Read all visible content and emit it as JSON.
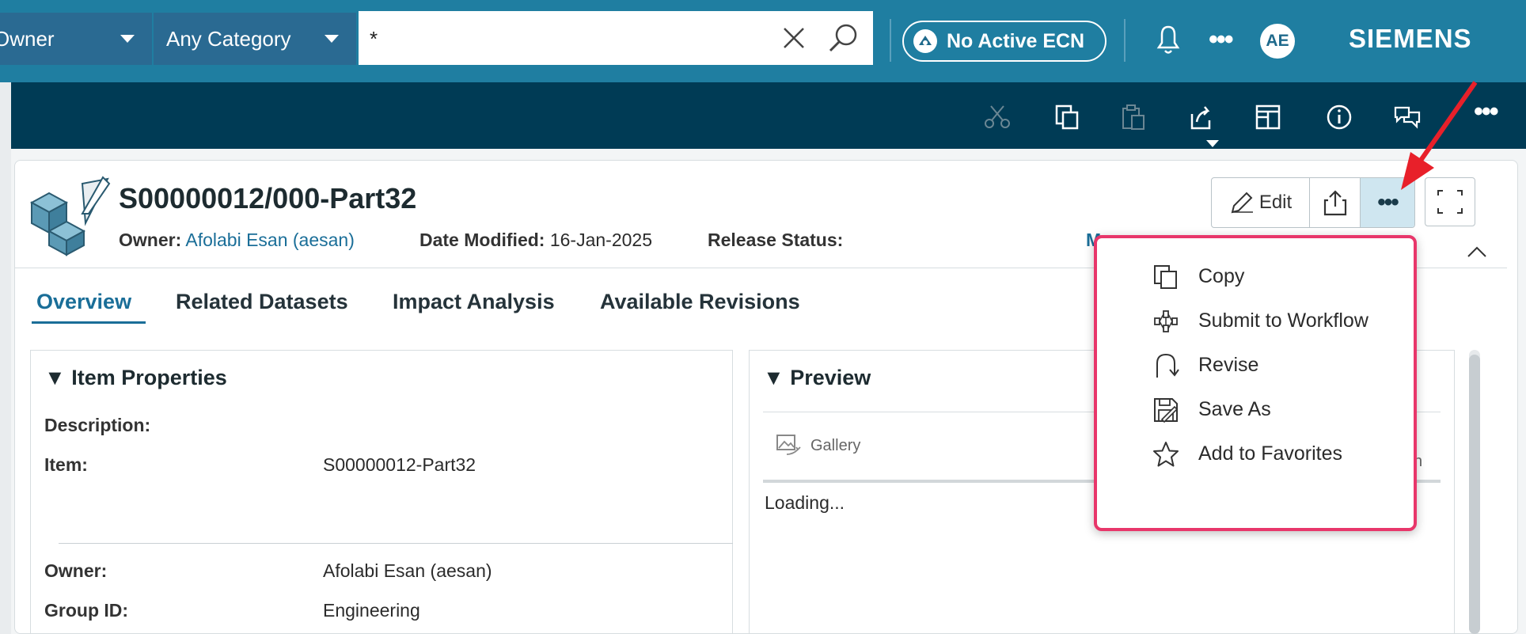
{
  "colors": {
    "header_bg": "#1f7ea1",
    "toolbar_bg": "#003b55",
    "accent": "#1a6e98",
    "highlight_border": "#e8366a",
    "annotation_arrow": "#e8202a"
  },
  "search_bar": {
    "owner_dropdown": "Owner",
    "category_dropdown": "Any Category",
    "query": "*",
    "clear_icon": "close-icon",
    "search_icon": "search-icon"
  },
  "header": {
    "ecn_label": "No Active ECN",
    "avatar_initials": "AE",
    "brand": "SIEMENS"
  },
  "toolbar": {
    "icons": [
      "scissors-icon",
      "copy-icon",
      "paste-icon",
      "share-icon",
      "layout-icon",
      "info-icon",
      "chat-icon",
      "more-icon"
    ]
  },
  "object": {
    "title": "S00000012/000-Part32",
    "owner_label": "Owner:",
    "owner_value": "Afolabi Esan (aesan)",
    "date_label": "Date Modified:",
    "date_value": "16-Jan-2025",
    "release_label": "Release Status:",
    "truncated_marker": "M"
  },
  "actions": {
    "edit_label": "Edit"
  },
  "tabs": [
    {
      "label": "Overview",
      "active": true
    },
    {
      "label": "Related Datasets",
      "active": false
    },
    {
      "label": "Impact Analysis",
      "active": false
    },
    {
      "label": "Available Revisions",
      "active": false
    }
  ],
  "item_properties": {
    "title": "▼ Item Properties",
    "description_label": "Description:",
    "item_label": "Item:",
    "item_value": "S00000012-Part32",
    "owner_label": "Owner:",
    "owner_value": "Afolabi Esan (aesan)",
    "group_label": "Group ID:",
    "group_value": "Engineering"
  },
  "preview": {
    "title": "▼ Preview",
    "gallery_label": "Gallery",
    "loading_text": "Loading...",
    "truncated_right": "n"
  },
  "more_menu": {
    "items": [
      {
        "label": "Copy",
        "icon": "copy-icon"
      },
      {
        "label": "Submit to Workflow",
        "icon": "workflow-icon"
      },
      {
        "label": "Revise",
        "icon": "revise-icon"
      },
      {
        "label": "Save As",
        "icon": "save-as-icon"
      },
      {
        "label": "Add to Favorites",
        "icon": "star-icon"
      }
    ]
  }
}
